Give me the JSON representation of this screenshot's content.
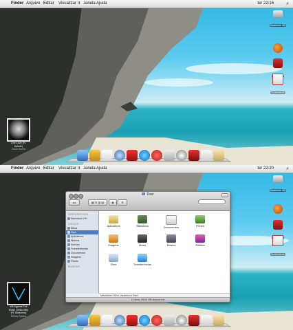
{
  "menubar_top": {
    "apple": "",
    "items": [
      "Finder",
      "Arquivo",
      "Editar",
      "Visualizar",
      "Ir",
      "Janela",
      "Ajuda"
    ],
    "clock": "ter 22:16",
    "spotlight": "⌕"
  },
  "menubar_bottom": {
    "apple": "",
    "items": [
      "Finder",
      "Arquivo",
      "Editar",
      "Visualizar",
      "Ir",
      "Janela",
      "Ajuda"
    ],
    "clock": "ter 22:20",
    "spotlight": "⌕"
  },
  "desktop_icons": [
    {
      "label": "Macintosh HD",
      "icon": "hard-drive-icon"
    },
    {
      "label": "Firefox",
      "icon": "firefox-icon"
    },
    {
      "label": "Snagshot",
      "icon": "snapshot-icon"
    },
    {
      "label": "Screenshots",
      "icon": "screenshot-icon"
    }
  ],
  "now_playing_top": {
    "title": "One Love (Ft. Estelle)",
    "artist": "David Guetta"
  },
  "now_playing_bottom": {
    "title": "We Against The Music (Video Mix) (Ft. Madonna)",
    "artist": "Britney Spears"
  },
  "finder": {
    "title": "Davi",
    "search_placeholder": "",
    "sidebar": {
      "sections": [
        {
          "header": "DISPOSITIVOS",
          "items": [
            {
              "label": "Macintosh HD",
              "selected": false
            }
          ]
        },
        {
          "header": "LOCAIS",
          "items": [
            {
              "label": "Mesa",
              "selected": false
            },
            {
              "label": "Davi",
              "selected": true
            },
            {
              "label": "Aplicativos",
              "selected": false
            },
            {
              "label": "Música",
              "selected": false
            },
            {
              "label": "Scenes",
              "selected": false
            },
            {
              "label": "Transferências",
              "selected": false
            },
            {
              "label": "Documentos",
              "selected": false
            },
            {
              "label": "Imagens",
              "selected": false
            },
            {
              "label": "Filmes",
              "selected": false
            }
          ]
        },
        {
          "header": "BUSCAR",
          "items": []
        }
      ]
    },
    "items": [
      {
        "label": "Aplicativos",
        "icon": "applications-folder-icon"
      },
      {
        "label": "Biblioteca",
        "icon": "library-folder-icon"
      },
      {
        "label": "Documentos",
        "icon": "documents-folder-icon"
      },
      {
        "label": "Filmes",
        "icon": "movies-folder-icon"
      },
      {
        "label": "Imagens",
        "icon": "pictures-folder-icon"
      },
      {
        "label": "Mesa",
        "icon": "desktop-folder-icon"
      },
      {
        "label": "Música",
        "icon": "music-folder-icon"
      },
      {
        "label": "Pública",
        "icon": "public-folder-icon"
      },
      {
        "label": "Sites",
        "icon": "sites-folder-icon"
      },
      {
        "label": "Transferências",
        "icon": "downloads-folder-icon"
      }
    ],
    "path": [
      "Macintosh HD",
      "Usuários",
      "Davi"
    ],
    "status": "10 itens, 59,63 GB disponíveis"
  },
  "colors": {
    "sidebar_selected": "#4a7cc2",
    "sky": "#2fb6e4",
    "sea": "#1aa0b3"
  }
}
